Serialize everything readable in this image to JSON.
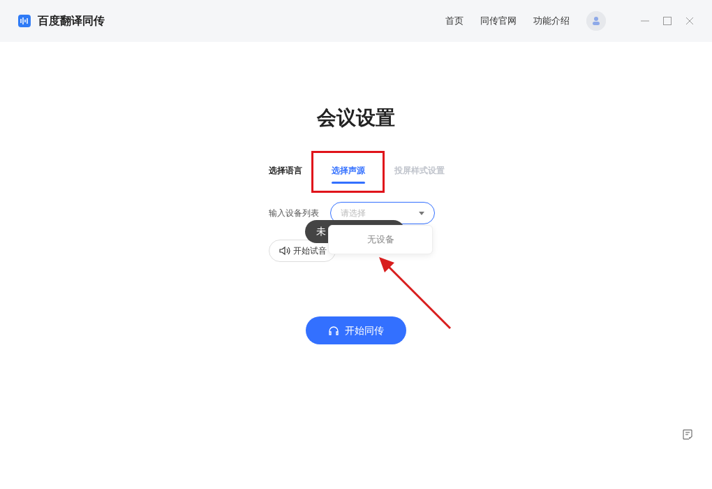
{
  "app": {
    "title": "百度翻译同传"
  },
  "nav": [
    {
      "label": "首页"
    },
    {
      "label": "同传官网"
    },
    {
      "label": "功能介绍"
    }
  ],
  "heading": "会议设置",
  "tabs": [
    {
      "label": "选择语言",
      "selected": false,
      "disabled": false
    },
    {
      "label": "选择声源",
      "selected": true,
      "disabled": false
    },
    {
      "label": "投屏样式设置",
      "selected": false,
      "disabled": true
    }
  ],
  "device": {
    "label": "输入设备列表",
    "placeholder": "请选择",
    "expanded": true,
    "options_empty_text": "无设备"
  },
  "tooltip": {
    "text": "未"
  },
  "test_button": {
    "label": "开始试音"
  },
  "start_button": {
    "label": "开始同传"
  }
}
